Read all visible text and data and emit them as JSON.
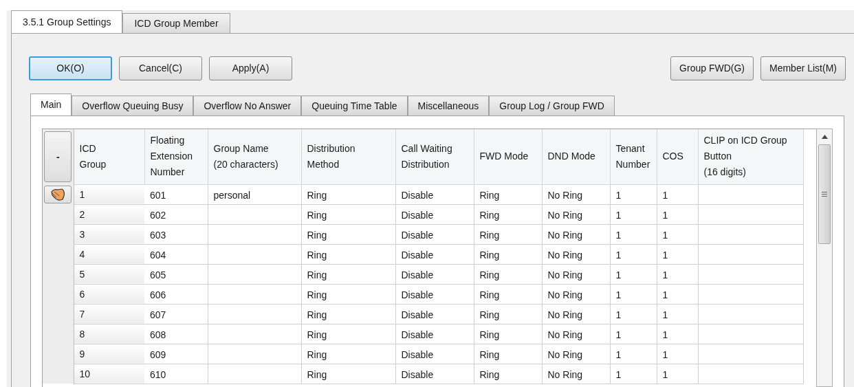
{
  "outer_tabs": [
    {
      "label": "3.5.1 Group Settings",
      "selected": true
    },
    {
      "label": "ICD Group Member",
      "selected": false
    }
  ],
  "left_buttons": [
    {
      "label": "OK(O)",
      "focused": true
    },
    {
      "label": "Cancel(C)",
      "focused": false
    },
    {
      "label": "Apply(A)",
      "focused": false
    }
  ],
  "right_buttons": [
    "Group FWD(G)",
    "Member List(M)"
  ],
  "inner_tabs": [
    {
      "label": "Main",
      "selected": true
    },
    {
      "label": "Overflow Queuing Busy",
      "selected": false
    },
    {
      "label": "Overflow No Answer",
      "selected": false
    },
    {
      "label": "Queuing Time Table",
      "selected": false
    },
    {
      "label": "Miscellaneous",
      "selected": false
    },
    {
      "label": "Group Log / Group FWD",
      "selected": false
    }
  ],
  "table": {
    "corner_button": "-",
    "columns": [
      "ICD\nGroup",
      "Floating\nExtension\nNumber",
      "Group Name\n(20 characters)",
      "Distribution\nMethod",
      "Call Waiting\nDistribution",
      "FWD Mode",
      "DND Mode",
      "Tenant\nNumber",
      "COS",
      "CLIP on ICD Group\nButton\n(16 digits)"
    ],
    "rows": [
      {
        "current": true,
        "cells": [
          "1",
          "601",
          "personal",
          "Ring",
          "Disable",
          "Ring",
          "No Ring",
          "1",
          "1",
          ""
        ]
      },
      {
        "current": false,
        "cells": [
          "2",
          "602",
          "",
          "Ring",
          "Disable",
          "Ring",
          "No Ring",
          "1",
          "1",
          ""
        ]
      },
      {
        "current": false,
        "cells": [
          "3",
          "603",
          "",
          "Ring",
          "Disable",
          "Ring",
          "No Ring",
          "1",
          "1",
          ""
        ]
      },
      {
        "current": false,
        "cells": [
          "4",
          "604",
          "",
          "Ring",
          "Disable",
          "Ring",
          "No Ring",
          "1",
          "1",
          ""
        ]
      },
      {
        "current": false,
        "cells": [
          "5",
          "605",
          "",
          "Ring",
          "Disable",
          "Ring",
          "No Ring",
          "1",
          "1",
          ""
        ]
      },
      {
        "current": false,
        "cells": [
          "6",
          "606",
          "",
          "Ring",
          "Disable",
          "Ring",
          "No Ring",
          "1",
          "1",
          ""
        ]
      },
      {
        "current": false,
        "cells": [
          "7",
          "607",
          "",
          "Ring",
          "Disable",
          "Ring",
          "No Ring",
          "1",
          "1",
          ""
        ]
      },
      {
        "current": false,
        "cells": [
          "8",
          "608",
          "",
          "Ring",
          "Disable",
          "Ring",
          "No Ring",
          "1",
          "1",
          ""
        ]
      },
      {
        "current": false,
        "cells": [
          "9",
          "609",
          "",
          "Ring",
          "Disable",
          "Ring",
          "No Ring",
          "1",
          "1",
          ""
        ]
      },
      {
        "current": false,
        "cells": [
          "10",
          "610",
          "",
          "Ring",
          "Disable",
          "Ring",
          "No Ring",
          "1",
          "1",
          ""
        ]
      }
    ]
  }
}
